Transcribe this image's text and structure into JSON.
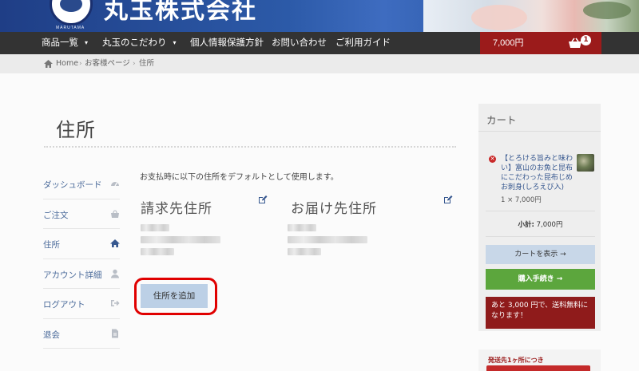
{
  "header": {
    "logo_text": "丸玉株式会社",
    "logo_sub": "MARUTAMA"
  },
  "nav": {
    "items": [
      {
        "label": "商品一覧",
        "caret": "▾"
      },
      {
        "label": "丸玉のこだわり",
        "caret": "▾"
      },
      {
        "label": "個人情報保護方針"
      },
      {
        "label": "お問い合わせ"
      },
      {
        "label": "ご利用ガイド"
      }
    ],
    "cart_amount": "7,000円",
    "cart_count": "1"
  },
  "breadcrumb": {
    "items": [
      "Home",
      "お客様ページ",
      "住所"
    ]
  },
  "page": {
    "title": "住所"
  },
  "account_nav": {
    "items": [
      {
        "label": "ダッシュボード",
        "icon": "dashboard-icon"
      },
      {
        "label": "ご注文",
        "icon": "basket-icon"
      },
      {
        "label": "住所",
        "icon": "home-icon",
        "active": true
      },
      {
        "label": "アカウント詳細",
        "icon": "user-icon"
      },
      {
        "label": "ログアウト",
        "icon": "sign-out-icon"
      },
      {
        "label": "退会",
        "icon": "file-icon"
      }
    ]
  },
  "addresses": {
    "intro": "お支払時に以下の住所をデフォルトとして使用します。",
    "billing_title": "請求先住所",
    "shipping_title": "お届け先住所",
    "add_button": "住所を追加"
  },
  "cart_widget": {
    "title": "カート",
    "item_name": "【とろける旨みと味わい】富山のお魚と昆布にこだわった昆布じめお刺身(しろえび入)",
    "item_qty": "1 × 7,000円",
    "subtotal_label": "小計:",
    "subtotal_value": "7,000円",
    "view_cart": "カートを表示 →",
    "checkout": "購入手続き →",
    "notice": "あと 3,000 円で、送料無料になります！"
  },
  "promo": {
    "text": "発送先1ヶ所につき"
  },
  "colors": {
    "nav_bg": "#333333",
    "cart_red": "#9b1b1b",
    "link_blue": "#36578f",
    "checkout_green": "#5ca63d",
    "highlight_red": "#e00000"
  }
}
